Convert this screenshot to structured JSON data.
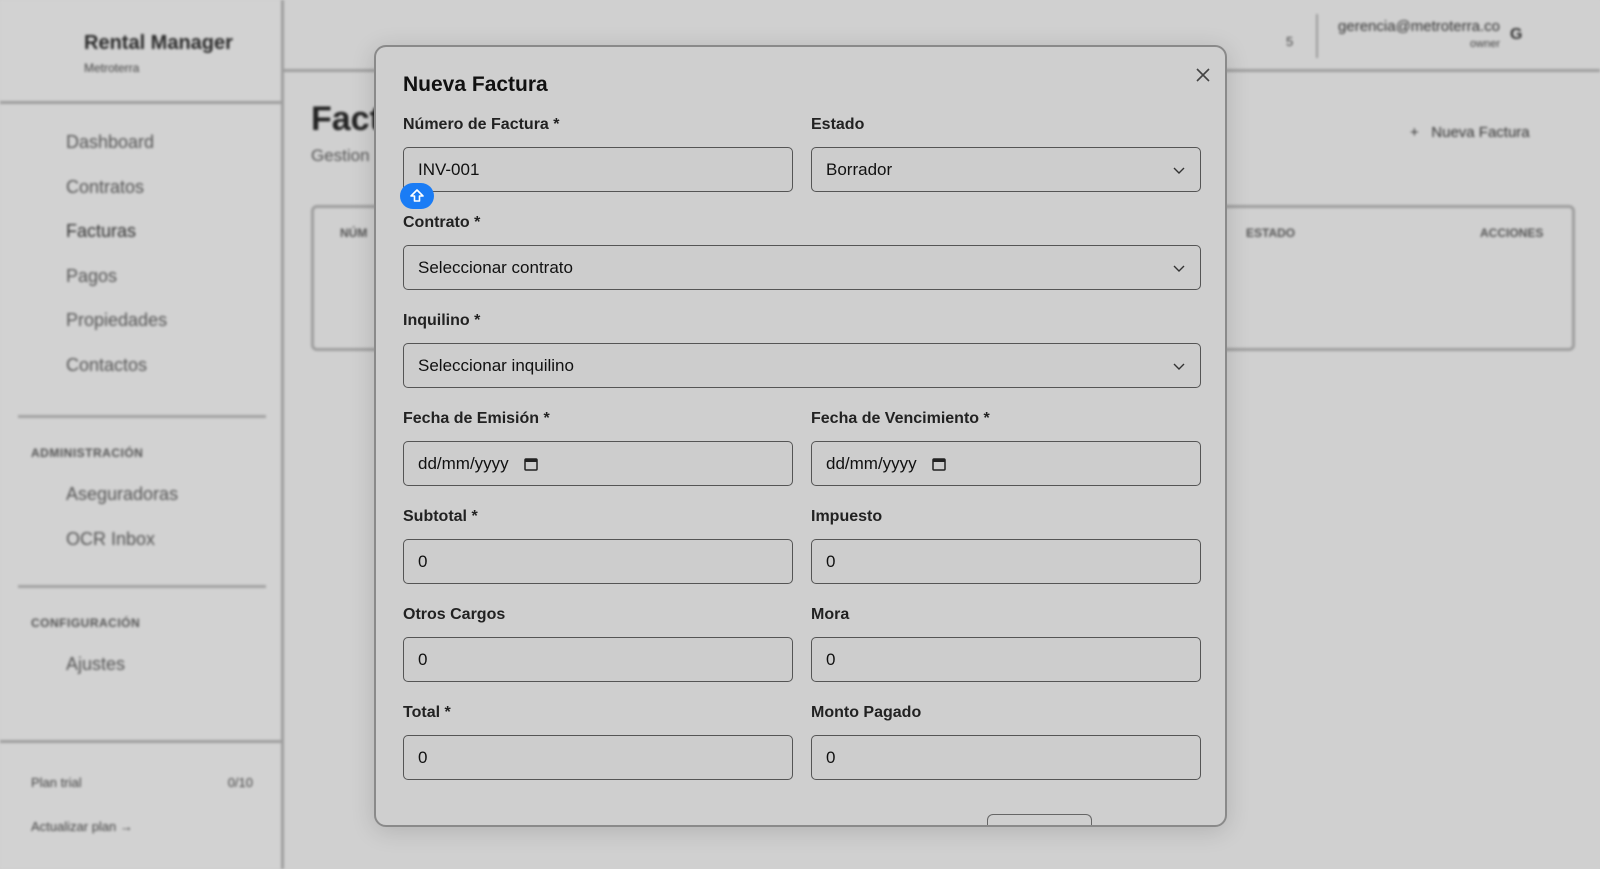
{
  "sidebar": {
    "brand_title": "Rental Manager",
    "brand_sub": "Metroterra",
    "nav": [
      "Dashboard",
      "Contratos",
      "Facturas",
      "Pagos",
      "Propiedades",
      "Contactos"
    ],
    "admin_label": "ADMINISTRACIÓN",
    "admin_items": [
      "Aseguradoras",
      "OCR Inbox"
    ],
    "config_label": "CONFIGURACIÓN",
    "config_items": [
      "Ajustes"
    ],
    "plan_label": "Plan trial",
    "plan_count": "0/10",
    "upgrade_label": "Actualizar plan →"
  },
  "topbar": {
    "count": "5",
    "email": "gerencia@metroterra.co",
    "role": "owner",
    "avatar_initial": "G"
  },
  "page": {
    "title": "Fact",
    "subtitle": "Gestion",
    "new_button_label": "Nueva Factura",
    "table_headers": [
      "NÚM",
      "ESTADO",
      "ACCIONES"
    ]
  },
  "modal": {
    "title": "Nueva Factura",
    "invoice_number": {
      "label": "Número de Factura *",
      "value": "INV-001"
    },
    "status": {
      "label": "Estado",
      "value": "Borrador"
    },
    "contract": {
      "label": "Contrato *",
      "value": "Seleccionar contrato"
    },
    "tenant": {
      "label": "Inquilino *",
      "value": "Seleccionar inquilino"
    },
    "issue_date": {
      "label": "Fecha de Emisión *",
      "value": "dd/mm/yyyy"
    },
    "due_date": {
      "label": "Fecha de Vencimiento *",
      "value": "dd/mm/yyyy"
    },
    "subtotal": {
      "label": "Subtotal *",
      "value": "0"
    },
    "tax": {
      "label": "Impuesto",
      "value": "0"
    },
    "other_charges": {
      "label": "Otros Cargos",
      "value": "0"
    },
    "late_fee": {
      "label": "Mora",
      "value": "0"
    },
    "total": {
      "label": "Total *",
      "value": "0"
    },
    "amount_paid": {
      "label": "Monto Pagado",
      "value": "0"
    }
  },
  "colors": {
    "backdrop": "#cfcfcf",
    "accent_cursor": "#1a7cf5"
  }
}
